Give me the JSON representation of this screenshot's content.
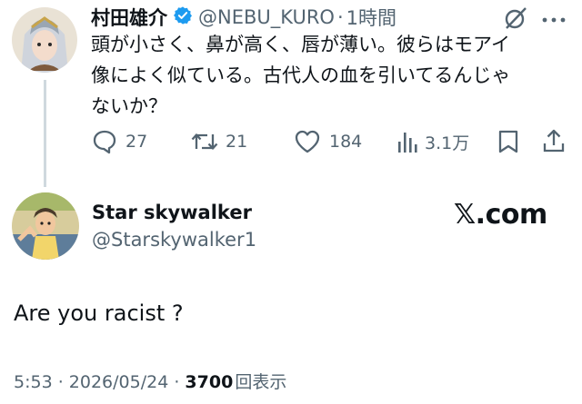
{
  "original_tweet": {
    "display_name": "村田雄介",
    "handle": "@NEBU_KURO",
    "separator": "·",
    "time": "1時間",
    "text_lines": [
      "頭が小さく、鼻が高く、唇が薄い。彼らはモアイ",
      "像によく似ている。古代人の血を引いてるんじゃ",
      "ないか？"
    ],
    "stats": {
      "replies": "27",
      "retweets": "21",
      "likes": "184",
      "views": "3.1万"
    }
  },
  "reply_tweet": {
    "display_name": "Star skywalker",
    "handle": "@Starskywalker1",
    "brand": "𝕏.com",
    "text": "Are you racist ?",
    "timestamp": "5:53 · 2026/05/24 · ",
    "view_count": "3700",
    "view_suffix": "回表示"
  },
  "colors": {
    "text": "#0f1419",
    "muted": "#536471",
    "verified": "#1d9bf0",
    "thread_line": "#cfd9de"
  },
  "icons": [
    "grok-icon",
    "more-icon",
    "reply-icon",
    "retweet-icon",
    "like-icon",
    "views-icon",
    "bookmark-icon",
    "share-icon",
    "verified-badge-icon"
  ]
}
